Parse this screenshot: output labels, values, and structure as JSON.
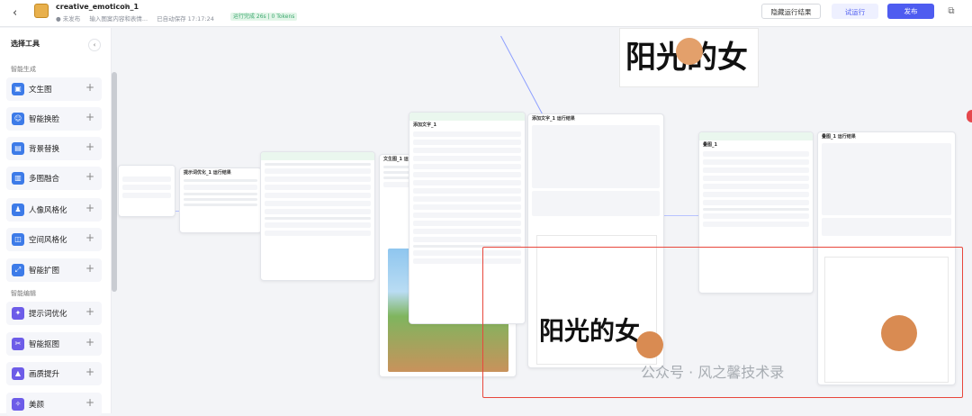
{
  "header": {
    "back_icon": "chevron-left-icon",
    "app_name": "creative_emoticon_1",
    "status": "● 未发布",
    "description": "输入图案内容和表情...",
    "autosave": "已自动保存 17:17:24",
    "run_stats": "运行完成 26s | 0 Tokens",
    "hide_results_label": "隐藏运行结果",
    "test_run_label": "试运行",
    "publish_label": "发布",
    "brand_color": "#4e5cf0"
  },
  "sidebar": {
    "title": "选择工具",
    "collapse_icon": "chevron-left-icon",
    "sections": [
      {
        "label": "智能生成"
      },
      {
        "label": "智能编辑"
      }
    ],
    "tools": [
      {
        "label": "文生图",
        "icon": "image-icon"
      },
      {
        "label": "智能换脸",
        "icon": "face-swap-icon"
      },
      {
        "label": "背景替换",
        "icon": "background-icon"
      },
      {
        "label": "多图融合",
        "icon": "merge-icon"
      },
      {
        "label": "人像风格化",
        "icon": "portrait-icon"
      },
      {
        "label": "空间风格化",
        "icon": "space-icon"
      },
      {
        "label": "智能扩图",
        "icon": "expand-icon"
      },
      {
        "label": "提示词优化",
        "icon": "prompt-icon"
      },
      {
        "label": "智能抠图",
        "icon": "cutout-icon"
      },
      {
        "label": "画质提升",
        "icon": "quality-icon"
      },
      {
        "label": "美颜",
        "icon": "beauty-icon"
      }
    ]
  },
  "canvas": {
    "overlay_text": "阳光的女",
    "watermark": "公众号 · 风之馨技术录",
    "cards": {
      "prompt_opt": "提示词优化_1 运行结果",
      "text_to_image": "文生图_1 运行结果",
      "add_text": "添加文字_1 运行结果",
      "plugin_1": "添加文字_1",
      "overlay_result": "叠图_1 运行结果",
      "plugin_2": "叠图_1"
    }
  }
}
